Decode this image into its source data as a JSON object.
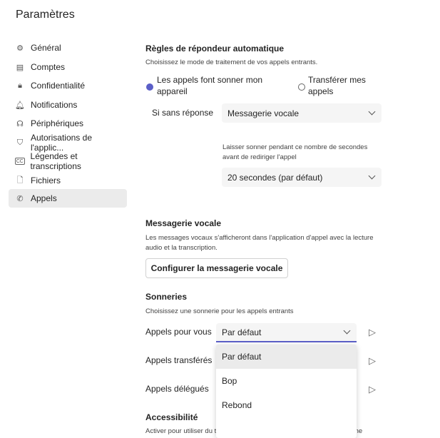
{
  "title": "Paramètres",
  "sidebar": {
    "items": [
      {
        "label": "Général",
        "icon": "gear-icon"
      },
      {
        "label": "Comptes",
        "icon": "id-card-icon"
      },
      {
        "label": "Confidentialité",
        "icon": "lock-icon"
      },
      {
        "label": "Notifications",
        "icon": "bell-icon"
      },
      {
        "label": "Périphériques",
        "icon": "headset-icon"
      },
      {
        "label": "Autorisations de l'applic...",
        "icon": "shield-icon"
      },
      {
        "label": "Légendes et transcriptions",
        "icon": "cc-icon"
      },
      {
        "label": "Fichiers",
        "icon": "file-icon"
      },
      {
        "label": "Appels",
        "icon": "phone-icon",
        "active": true
      }
    ]
  },
  "answer": {
    "heading": "Règles de répondeur automatique",
    "desc": "Choisissez le mode de traitement de vos appels entrants.",
    "radio1": "Les appels font sonner mon appareil",
    "radio1_l1": "Les appels font sonner mon",
    "radio1_l2": "appareil",
    "radio2_l1": "Transférer mes",
    "radio2_l2": "appels",
    "noanswer_label": "Si sans réponse",
    "noanswer_value": "Messagerie vocale",
    "ring_desc_l1": "Laisser sonner pendant ce nombre de secondes",
    "ring_desc_l2": "avant de rediriger l'appel",
    "ring_value": "20 secondes (par défaut)"
  },
  "voicemail": {
    "heading": "Messagerie vocale",
    "desc_l1": "Les messages vocaux s'afficheront dans l'application d'appel avec la lecture",
    "desc_l2": "audio et la transcription.",
    "button": "Configurer la messagerie vocale"
  },
  "ringtones": {
    "heading": "Sonneries",
    "desc": "Choisissez une sonnerie pour les appels entrants",
    "rows": [
      {
        "label": "Appels pour vous",
        "value": "Par défaut"
      },
      {
        "label": "Appels transférés"
      },
      {
        "label": "Appels délégués"
      }
    ],
    "options": [
      "Par défaut",
      "Bop",
      "Rebond"
    ]
  },
  "accessibility": {
    "heading": "Accessibilité",
    "desc": "Activer pour utiliser du texte pour communiquer via la ligne de téléphone"
  },
  "accent": "#5b5fc7"
}
